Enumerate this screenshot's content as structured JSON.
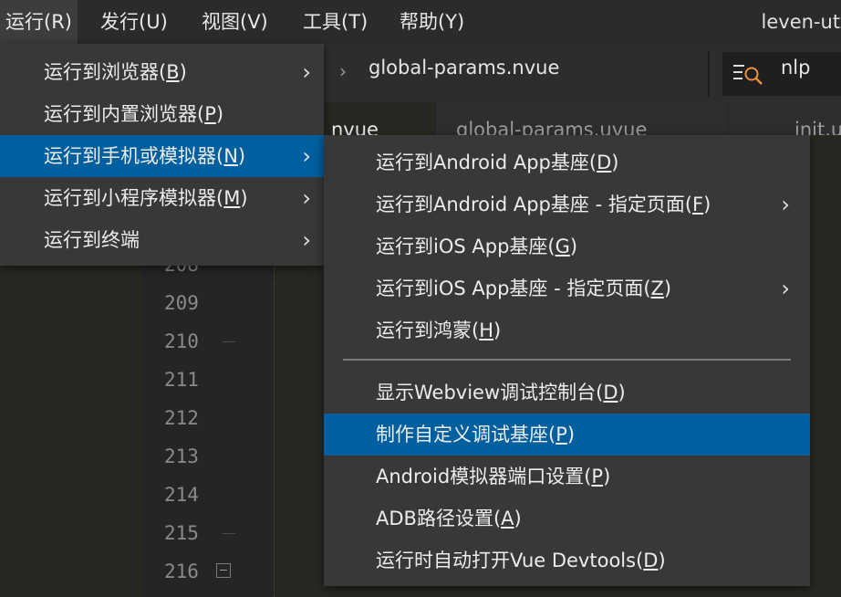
{
  "menubar": {
    "items": [
      {
        "label": "运行(R)",
        "active": true
      },
      {
        "label": "发行(U)",
        "active": false
      },
      {
        "label": "视图(V)",
        "active": false
      },
      {
        "label": "工具(T)",
        "active": false
      },
      {
        "label": "帮助(Y)",
        "active": false
      }
    ],
    "app_title": "leven-uts"
  },
  "editor": {
    "breadcrumb_file": "global-params.nvue",
    "search_text": "nlp",
    "tabs": [
      {
        "label": "nvue",
        "active": true
      },
      {
        "label": "global-params.uvue",
        "active": false
      },
      {
        "label": "init.u",
        "active": false
      }
    ],
    "line_numbers": [
      "208",
      "209",
      "210",
      "211",
      "212",
      "213",
      "214",
      "215",
      "216"
    ]
  },
  "run_menu": {
    "items": [
      {
        "prefix": "运行到浏览器(",
        "key": "B",
        "suffix": ")",
        "has_submenu": true
      },
      {
        "prefix": "运行到内置浏览器(",
        "key": "P",
        "suffix": ")",
        "has_submenu": false
      },
      {
        "prefix": "运行到手机或模拟器(",
        "key": "N",
        "suffix": ")",
        "has_submenu": true
      },
      {
        "prefix": "运行到小程序模拟器(",
        "key": "M",
        "suffix": ")",
        "has_submenu": true
      },
      {
        "prefix": "运行到终端",
        "key": "",
        "suffix": "",
        "has_submenu": true
      }
    ],
    "highlighted": "运行到手机或模拟器(N)"
  },
  "device_submenu": {
    "items": [
      {
        "prefix": "运行到Android App基座(",
        "key": "D",
        "suffix": ")",
        "has_submenu": false
      },
      {
        "prefix": "运行到Android App基座 - 指定页面(",
        "key": "F",
        "suffix": ")",
        "has_submenu": true
      },
      {
        "prefix": "运行到iOS App基座(",
        "key": "G",
        "suffix": ")",
        "has_submenu": false
      },
      {
        "prefix": "运行到iOS App基座 - 指定页面(",
        "key": "Z",
        "suffix": ")",
        "has_submenu": true
      },
      {
        "prefix": "运行到鸿蒙(",
        "key": "H",
        "suffix": ")",
        "has_submenu": false
      },
      {
        "prefix": "显示Webview调试控制台(",
        "key": "D",
        "suffix": ")",
        "has_submenu": false
      },
      {
        "prefix": "制作自定义调试基座(",
        "key": "P",
        "suffix": ")",
        "has_submenu": false
      },
      {
        "prefix": "Android模拟器端口设置(",
        "key": "P",
        "suffix": ")",
        "has_submenu": false
      },
      {
        "prefix": "ADB路径设置(",
        "key": "A",
        "suffix": ")",
        "has_submenu": false
      },
      {
        "prefix": "运行时自动打开Vue Devtools(",
        "key": "D",
        "suffix": ")",
        "has_submenu": false
      }
    ],
    "highlighted": "制作自定义调试基座(P)"
  },
  "icons": {
    "submenu_arrow": "chevron-right-icon",
    "search": "search-icon",
    "fold": "fold-collapse-icon"
  },
  "colors": {
    "menubar_bg": "#2b2b2b",
    "menu_bg": "#383838",
    "highlight": "#005f9e",
    "editor_bg": "#272822"
  }
}
